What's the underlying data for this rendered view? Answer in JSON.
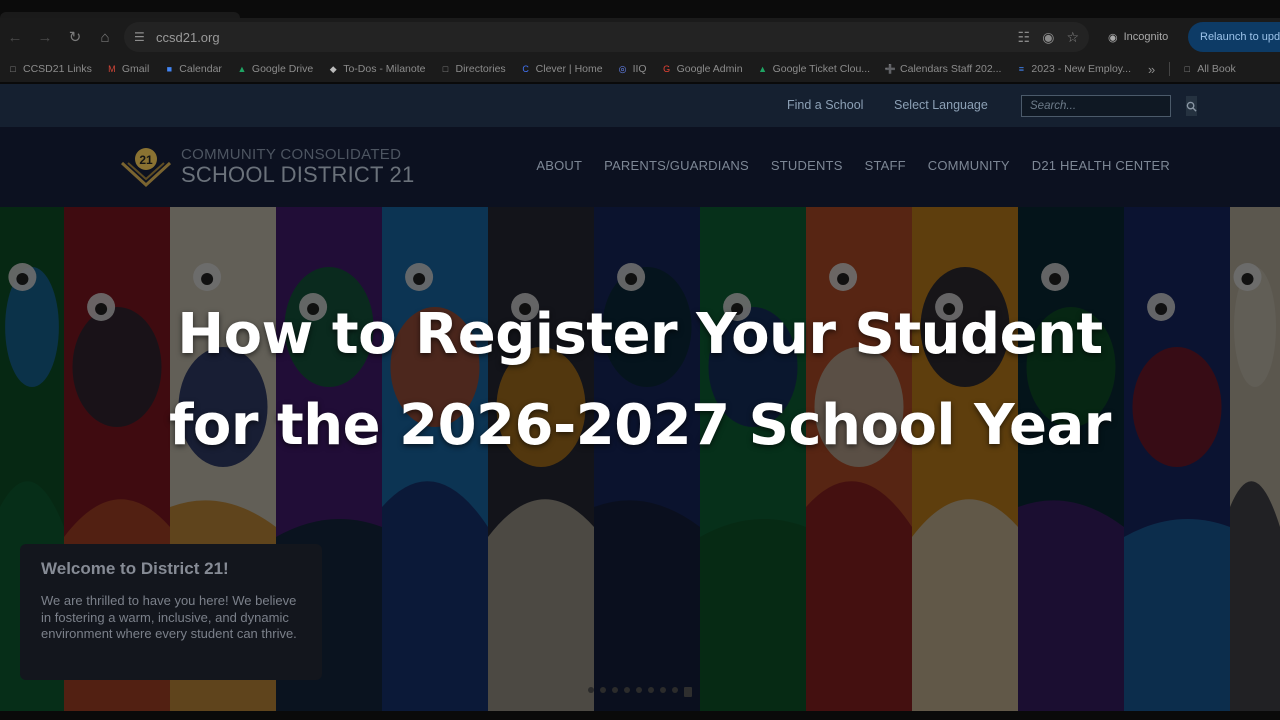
{
  "browser": {
    "url": "ccsd21.org",
    "incognito_label": "Incognito",
    "relaunch_label": "Relaunch to upda",
    "bookmarks": [
      {
        "label": "CCSD21 Links",
        "icon": "folder-icon",
        "color": "#8c8c8c"
      },
      {
        "label": "Gmail",
        "icon": "gmail-icon",
        "color": "#d44638"
      },
      {
        "label": "Calendar",
        "icon": "calendar-icon",
        "color": "#4285f4"
      },
      {
        "label": "Google Drive",
        "icon": "drive-icon",
        "color": "#1fa463"
      },
      {
        "label": "To-Dos - Milanote",
        "icon": "milanote-icon",
        "color": "#bbbbbb"
      },
      {
        "label": "Directories",
        "icon": "folder-icon",
        "color": "#8c8c8c"
      },
      {
        "label": "Clever | Home",
        "icon": "clever-icon",
        "color": "#4274f6"
      },
      {
        "label": "IIQ",
        "icon": "iiq-icon",
        "color": "#6b8cff"
      },
      {
        "label": "Google Admin",
        "icon": "google-icon",
        "color": "#ea4335"
      },
      {
        "label": "Google Ticket Clou...",
        "icon": "drive-icon",
        "color": "#1fa463"
      },
      {
        "label": "Calendars Staff 202...",
        "icon": "sheets-icon",
        "color": "#0f9d58"
      },
      {
        "label": "2023 - New Employ...",
        "icon": "docs-icon",
        "color": "#4285f4"
      }
    ],
    "all_bookmarks_label": "All Book"
  },
  "site": {
    "util_links": {
      "find_school": "Find a School",
      "select_language": "Select Language"
    },
    "search_placeholder": "Search...",
    "logo": {
      "badge": "21",
      "line1": "COMMUNITY CONSOLIDATED",
      "line2": "SCHOOL DISTRICT 21"
    },
    "nav": [
      "ABOUT",
      "PARENTS/GUARDIANS",
      "STUDENTS",
      "STAFF",
      "COMMUNITY",
      "D21 HEALTH CENTER"
    ]
  },
  "hero": {
    "title_line1": "How to Register Your Student",
    "title_line2": "for the 2026-2027 School Year"
  },
  "welcome": {
    "heading": "Welcome to District 21!",
    "body": "We are thrilled to have you here! We believe in fostering a warm, inclusive, and dynamic environment where every student can thrive."
  },
  "colors": {
    "overlay": "#000000",
    "stripes": [
      "#0f5a2a",
      "#8c1a24",
      "#d9d2c2",
      "#4a1d7a",
      "#1c73b8",
      "#2a2d3a",
      "#1a2a66",
      "#0e6a3a",
      "#c2522a",
      "#d0891d",
      "#0a2e3a",
      "#1a2a6e",
      "#c9c0ae",
      "#17213b"
    ]
  }
}
